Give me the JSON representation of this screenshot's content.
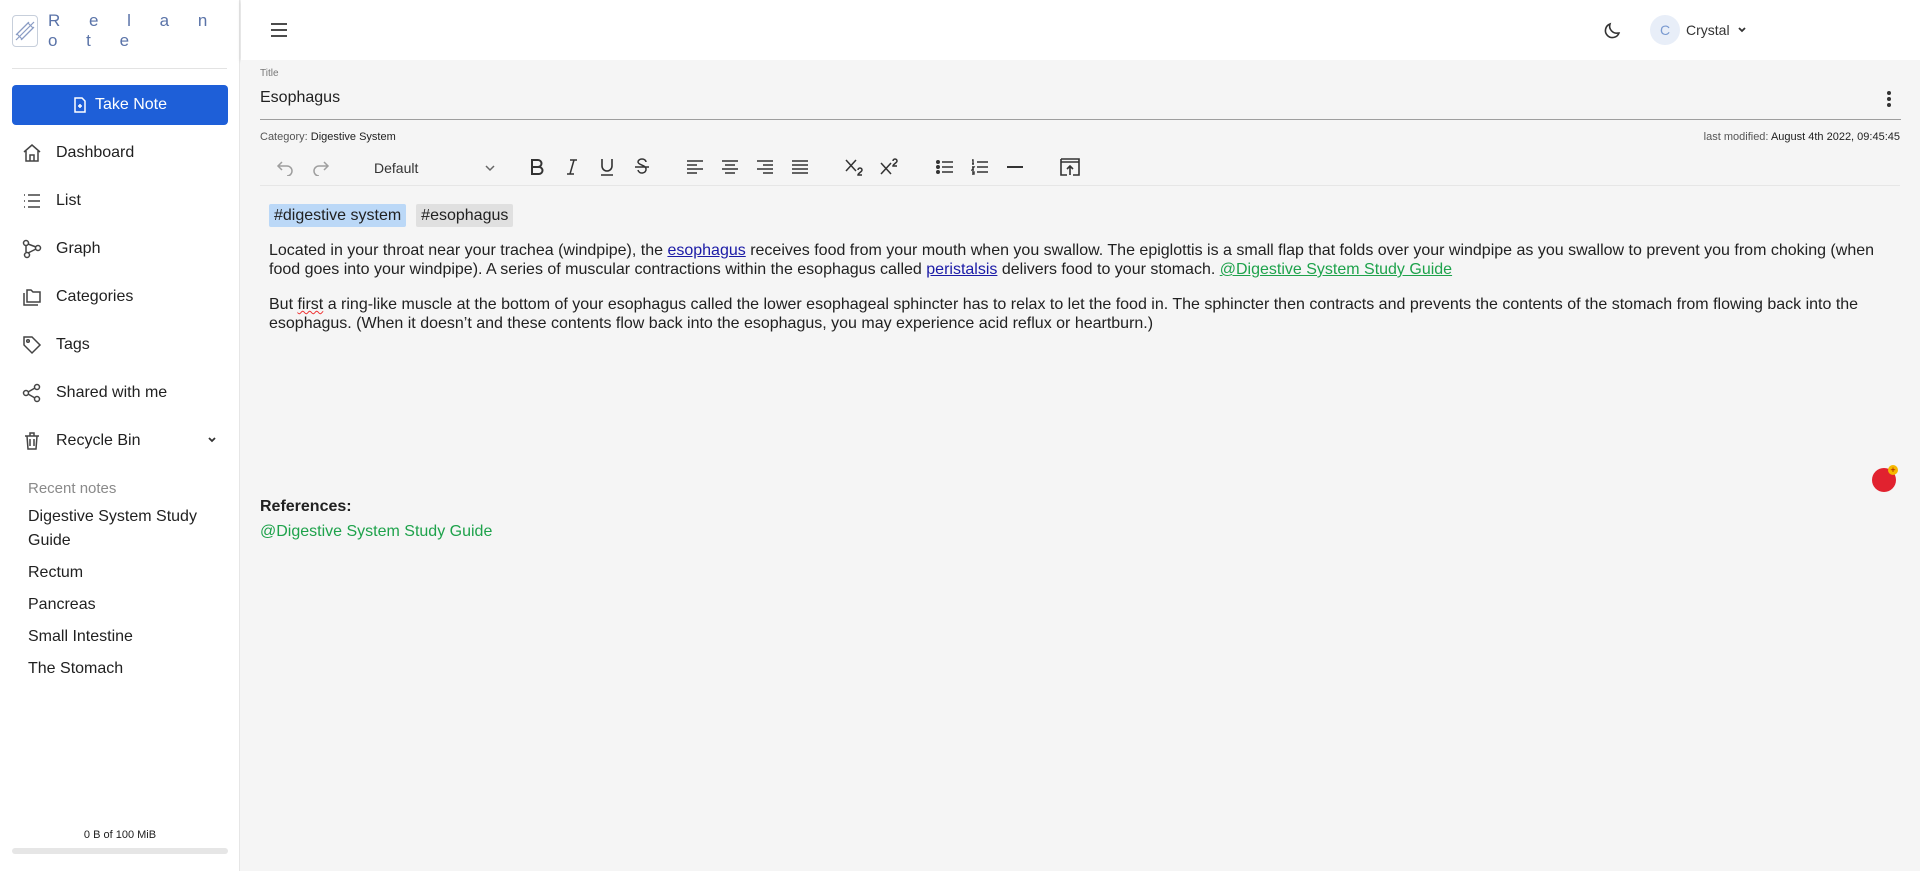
{
  "app": {
    "name": "R e l a n o t e"
  },
  "sidebar": {
    "take_note_label": "Take Note",
    "nav": [
      {
        "label": "Dashboard",
        "icon": "home-icon"
      },
      {
        "label": "List",
        "icon": "list-icon"
      },
      {
        "label": "Graph",
        "icon": "graph-icon"
      },
      {
        "label": "Categories",
        "icon": "folders-icon"
      },
      {
        "label": "Tags",
        "icon": "tag-icon"
      },
      {
        "label": "Shared with me",
        "icon": "share-icon"
      },
      {
        "label": "Recycle Bin",
        "icon": "trash-icon"
      }
    ],
    "recent_title": "Recent notes",
    "recent": [
      "Digestive System Study Guide",
      "Rectum",
      "Pancreas",
      "Small Intestine",
      "The Stomach"
    ],
    "storage_text": "0 B of 100 MiB",
    "storage_used_fraction": 0
  },
  "header": {
    "user_initial": "C",
    "user_name": "Crystal"
  },
  "note": {
    "title_label": "Title",
    "title": "Esophagus",
    "category_label": "Category:",
    "category": "Digestive System",
    "modified_label": "last modified:",
    "modified": "August 4th 2022, 09:45:45",
    "format_value": "Default",
    "tags": [
      "#digestive system",
      "#esophagus"
    ],
    "p1": {
      "t1": "Located in your throat near your trachea (windpipe), the ",
      "link1": "esophagus",
      "t2": " receives food from your mouth when you swallow. The epiglottis is a small flap that folds over your windpipe as you swallow to prevent you from choking (when food goes into your windpipe). A series of muscular contractions within the esophagus called ",
      "link2": "peristalsis",
      "t3": " delivers food to your stomach. ",
      "mention": "@Digestive System Study Guide"
    },
    "p2": {
      "t1": "But ",
      "spell": "first",
      "t2": " a ring-like muscle at the bottom of your esophagus called the lower esophageal sphincter has to relax to let the food in. The sphincter then contracts and prevents the contents of the stomach from flowing back into the esophagus. (When it doesn’t and these contents flow back into the esophagus, you may experience acid reflux or heartburn.)"
    },
    "references_title": "References:",
    "references": [
      "@Digestive System Study Guide"
    ]
  },
  "colors": {
    "primary": "#1e5fd8",
    "mention": "#1ea24b",
    "link": "#1a1aa6",
    "tag_primary": "#bbd8f7",
    "tag_secondary": "#e0e0e0",
    "fab": "#e1222f"
  }
}
